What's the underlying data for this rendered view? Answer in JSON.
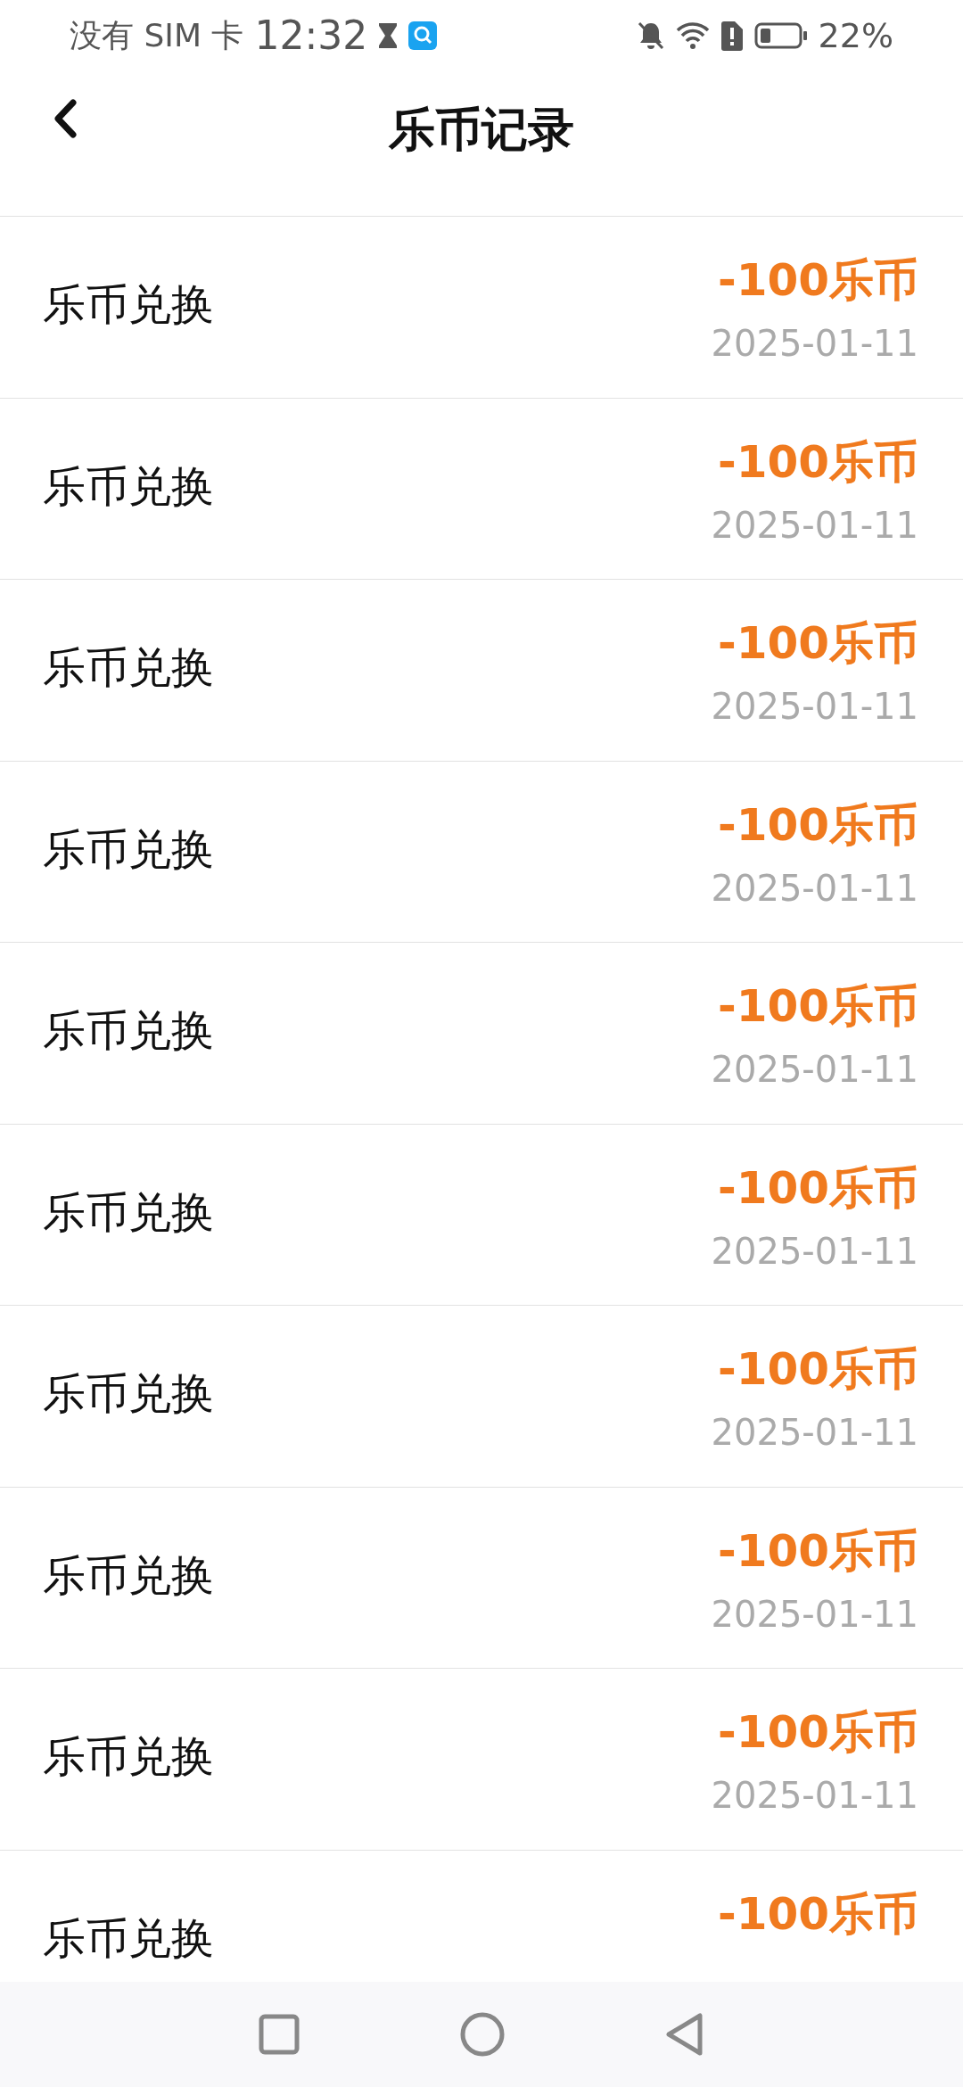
{
  "status_bar": {
    "carrier": "没有 SIM 卡",
    "time": "12:32",
    "battery": "22%"
  },
  "header": {
    "title": "乐币记录"
  },
  "records": [
    {
      "title": "乐币兑换",
      "amount": "-100乐币",
      "date": "2025-01-11"
    },
    {
      "title": "乐币兑换",
      "amount": "-100乐币",
      "date": "2025-01-11"
    },
    {
      "title": "乐币兑换",
      "amount": "-100乐币",
      "date": "2025-01-11"
    },
    {
      "title": "乐币兑换",
      "amount": "-100乐币",
      "date": "2025-01-11"
    },
    {
      "title": "乐币兑换",
      "amount": "-100乐币",
      "date": "2025-01-11"
    },
    {
      "title": "乐币兑换",
      "amount": "-100乐币",
      "date": "2025-01-11"
    },
    {
      "title": "乐币兑换",
      "amount": "-100乐币",
      "date": "2025-01-11"
    },
    {
      "title": "乐币兑换",
      "amount": "-100乐币",
      "date": "2025-01-11"
    },
    {
      "title": "乐币兑换",
      "amount": "-100乐币",
      "date": "2025-01-11"
    },
    {
      "title": "乐币兑换",
      "amount": "-100乐币"
    }
  ]
}
